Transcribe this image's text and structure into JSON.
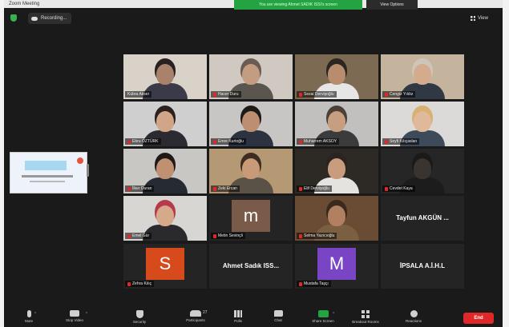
{
  "window": {
    "title": "Zoom Meeting"
  },
  "share_banner": "You are viewing Ahmet SADIK ISSI's screen",
  "view_options_label": "View Options",
  "recording_label": "Recording...",
  "view_label": "View",
  "participants": [
    {
      "name": "Kübra Akser",
      "muted": false,
      "type": "video",
      "bg": "#d8d2c8",
      "skin": "#a8826a",
      "hair": "#2a2020",
      "shirt": "#3a3a48"
    },
    {
      "name": "Hacer Duru",
      "muted": true,
      "type": "video",
      "bg": "#cfc9c2",
      "skin": "#c39d82",
      "hair": "#6a5c52",
      "shirt": "#5a564f"
    },
    {
      "name": "Sezai Dervişoğlu",
      "muted": true,
      "type": "video",
      "bg": "#7d6a52",
      "skin": "#b88d6e",
      "hair": "#2b2622",
      "shirt": "#e6e6e6",
      "speaking": true
    },
    {
      "name": "Cengiz Yıldız",
      "muted": true,
      "type": "video",
      "bg": "#c4b49e",
      "skin": "#d4ab8c",
      "hair": "#cfc4b8",
      "shirt": "#303844"
    },
    {
      "name": "Ebru ÖZTÜRK",
      "muted": true,
      "type": "video",
      "bg": "#cfcfcf",
      "skin": "#d0a588",
      "hair": "#2c211c",
      "shirt": "#2a2a30"
    },
    {
      "name": "Emre Kurtoğlu",
      "muted": true,
      "type": "video",
      "bg": "#c8c6c4",
      "skin": "#bd8f70",
      "hair": "#1e1a18",
      "shirt": "#2c3240"
    },
    {
      "name": "Muharrem AKSOY",
      "muted": true,
      "type": "video",
      "bg": "#c2c0bf",
      "skin": "#c89e80",
      "hair": "#4a4038",
      "shirt": "#3b3b3b"
    },
    {
      "name": "Seyfi Kılıçaslan",
      "muted": true,
      "type": "video",
      "bg": "#dcdad8",
      "skin": "#e0b89a",
      "hair": "#d8b070",
      "shirt": "#3c4a5a"
    },
    {
      "name": "İlker Duran",
      "muted": true,
      "type": "video",
      "bg": "#c9c7c4",
      "skin": "#c09070",
      "hair": "#1e1a18",
      "shirt": "#262a33"
    },
    {
      "name": "Zeki Ercan",
      "muted": true,
      "type": "video",
      "bg": "#b59874",
      "skin": "#c99a78",
      "hair": "#3e2c22",
      "shirt": "#5a5246"
    },
    {
      "name": "Elif Dervişoğlu",
      "muted": true,
      "type": "video",
      "bg": "#2d2a26",
      "skin": "#c89c7c",
      "hair": "#2a2420",
      "shirt": "#e5e3df"
    },
    {
      "name": "Cevdet Kaya",
      "muted": true,
      "type": "video",
      "bg": "#262626",
      "skin": "#3a3430",
      "hair": "#1a1a1a",
      "shirt": "#1c1c1c"
    },
    {
      "name": "Emel Gür",
      "muted": true,
      "type": "video",
      "bg": "#d8d6d2",
      "skin": "#d6a98a",
      "hair": "#b63a4a",
      "shirt": "#2a2a2e"
    },
    {
      "name": "Metin Sevinçli",
      "muted": true,
      "type": "avatar",
      "letter": "m",
      "color": "#7a5a48"
    },
    {
      "name": "Selma Yazıcıoğlu",
      "muted": true,
      "type": "video",
      "bg": "#6a4c34",
      "skin": "#b08060",
      "hair": "#3a2a1e",
      "shirt": "#7a6040"
    },
    {
      "name": "Tayfun AKGÜN ...",
      "muted": false,
      "type": "name"
    },
    {
      "name": "Zehra Kılıç",
      "muted": true,
      "type": "avatar",
      "letter": "S",
      "color": "#d64a1c"
    },
    {
      "name": "Ahmet Sadık ISS...",
      "muted": false,
      "type": "name"
    },
    {
      "name": "Mustafa Taşçı",
      "muted": true,
      "type": "avatar",
      "letter": "M",
      "color": "#7a45c4"
    },
    {
      "name": "İPSALA A.İ.H.L",
      "muted": false,
      "type": "name"
    }
  ],
  "toolbar": [
    {
      "label": "Mute",
      "icon": "microphone-icon",
      "cls": "mic"
    },
    {
      "label": "Stop Video",
      "icon": "video-camera-icon",
      "cls": "cam"
    },
    {
      "label": "Security",
      "icon": "shield-icon",
      "cls": "shield2"
    },
    {
      "label": "Participants",
      "icon": "participants-icon",
      "cls": "users",
      "count": "27"
    },
    {
      "label": "Polls",
      "icon": "poll-icon",
      "cls": "poll"
    },
    {
      "label": "Chat",
      "icon": "chat-icon",
      "cls": "chat"
    },
    {
      "label": "Share Screen",
      "icon": "share-screen-icon",
      "cls": "share"
    },
    {
      "label": "Breakout Rooms",
      "icon": "breakout-rooms-icon",
      "cls": "rooms"
    },
    {
      "label": "Reactions",
      "icon": "reactions-icon",
      "cls": "react"
    }
  ],
  "end_label": "End"
}
